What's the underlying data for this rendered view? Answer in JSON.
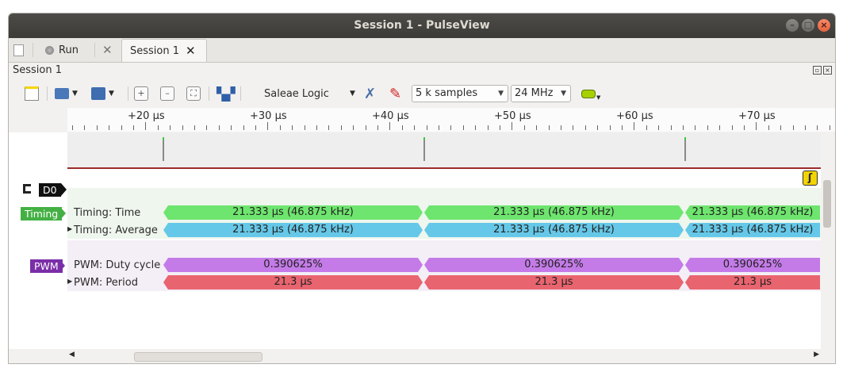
{
  "window": {
    "title": "Session 1 - PulseView"
  },
  "tabbar": {
    "run_label": "Run",
    "tab_label": "Session 1"
  },
  "session_header": "Session 1",
  "toolbar": {
    "device": "Saleae Logic",
    "samples": "5 k samples",
    "rate": "24 MHz"
  },
  "ruler": {
    "labels": [
      "+20 µs",
      "+30 µs",
      "+40 µs",
      "+50 µs",
      "+60 µs",
      "+70 µs"
    ]
  },
  "channels": {
    "d0": {
      "name": "D0"
    }
  },
  "decoders": {
    "timing": {
      "badge": "Timing",
      "row1_label": "Timing: Time",
      "row2_label": "Timing: Average",
      "time_values": [
        "21.333 µs (46.875 kHz)",
        "21.333 µs (46.875 kHz)",
        "21.333 µs (46.875 kHz)"
      ],
      "average_values": [
        "21.333 µs (46.875 kHz)",
        "21.333 µs (46.875 kHz)",
        "21.333 µs (46.875 kHz)"
      ],
      "colors": {
        "time": "#6ee56e",
        "average": "#66c8e8"
      }
    },
    "pwm": {
      "badge": "PWM",
      "row1_label": "PWM: Duty cycle",
      "row2_label": "PWM: Period",
      "duty_values": [
        "0.390625%",
        "0.390625%",
        "0.390625%"
      ],
      "period_values": [
        "21.3 µs",
        "21.3 µs",
        "21.3 µs"
      ],
      "colors": {
        "duty": "#c47be8",
        "period": "#e8646e"
      }
    }
  },
  "colors": {
    "timing_badge": "#44b044",
    "pwm_badge": "#7a2ea8",
    "d0_trigger": "#f2d400"
  }
}
